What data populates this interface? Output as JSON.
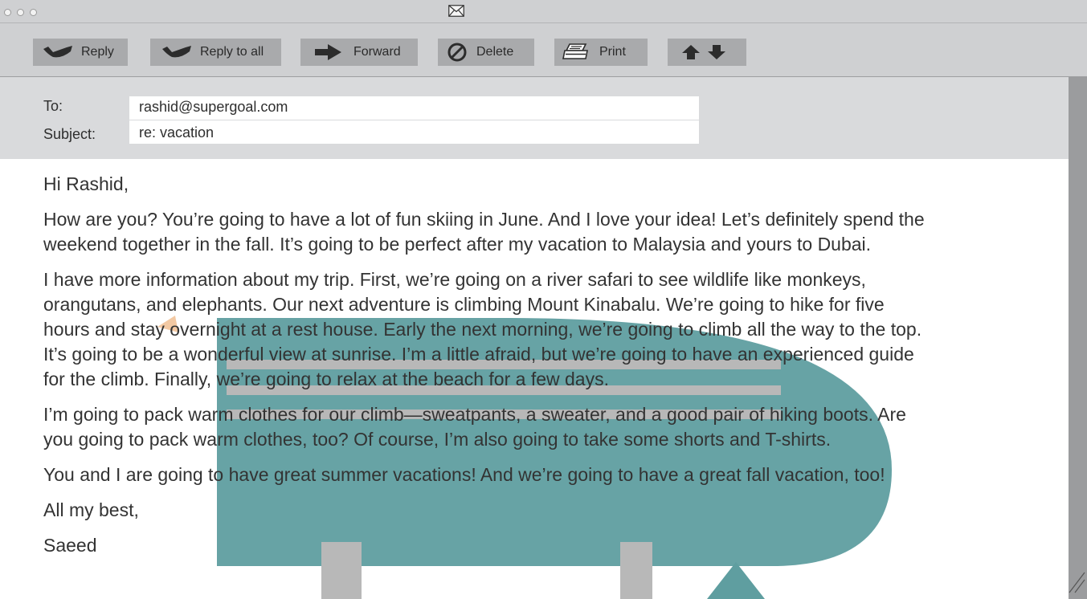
{
  "toolbar": {
    "reply_label": "Reply",
    "reply_all_label": "Reply to all",
    "forward_label": "Forward",
    "delete_label": "Delete",
    "print_label": "Print"
  },
  "header": {
    "to_label": "To:",
    "to_value": "rashid@supergoal.com",
    "subject_label": "Subject:",
    "subject_value": "re: vacation"
  },
  "message": {
    "greeting": "Hi Rashid,",
    "p1_l1": "How are you? You’re going to have a lot of fun skiing in June. And I love your idea! Let’s definitely spend the",
    "p1_l2": "weekend together in the fall. It’s going to be perfect after my vacation to Malaysia and yours to Dubai.",
    "p2_l1": "I have more information about my trip. First, we’re going on a river safari to see wildlife like monkeys,",
    "p2_l2": "orangutans, and elephants. Our next adventure is climbing Mount Kinabalu. We’re going to hike for five",
    "p2_l3": "hours and stay overnight at a rest house. Early the next morning, we’re going to climb all the way to the top.",
    "p2_l4": "It’s going to be a wonderful view at sunrise. I’m a little afraid, but we’re going to have an experienced guide",
    "p2_l5": "for the climb. Finally, we’re going to relax at the beach for a few days.",
    "p3_l1": "I’m going to pack warm clothes for our climb—sweatpants, a sweater, and a good pair of hiking boots. Are",
    "p3_l2": "you going to pack warm clothes, too? Of course, I’m also going to take some shorts and T-shirts.",
    "p4": "You and I are going to have great summer vacations! And we’re going to have a great fall vacation, too!",
    "closing": "All my best,",
    "signature": "Saeed"
  },
  "colors": {
    "watermark_teal": "#5f9ea0",
    "watermark_gray": "#b8b8b8",
    "toolbar_bg": "#cfd0d2",
    "button_bg": "#a9aaac",
    "header_bg": "#d9dadc"
  },
  "icons": [
    "mail-icon",
    "reply-icon",
    "reply-all-icon",
    "forward-icon",
    "delete-icon",
    "print-icon",
    "arrow-up-icon",
    "arrow-down-icon",
    "resize-grip-icon"
  ]
}
